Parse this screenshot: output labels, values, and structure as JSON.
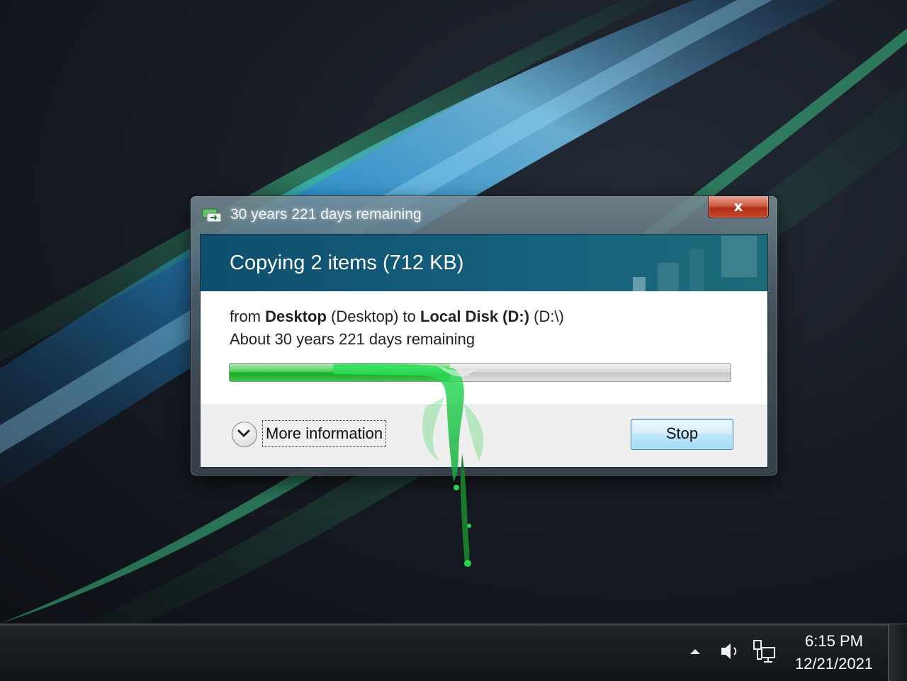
{
  "window": {
    "title": "30 years 221 days remaining",
    "close_label": "x",
    "heading": "Copying 2 items (712 KB)",
    "from_prefix": "from",
    "source_name": "Desktop",
    "source_detail": "(Desktop)",
    "to_word": "to",
    "dest_name": "Local Disk (D:)",
    "dest_detail": "(D:\\)",
    "remaining_text": "About 30 years 221 days remaining",
    "progress_fraction": 0.44,
    "more_info_label": "More information",
    "stop_label": "Stop"
  },
  "taskbar": {
    "time": "6:15 PM",
    "date": "12/21/2021",
    "tray_icons": [
      "show-hidden-icons-arrow-icon",
      "volume-icon",
      "network-icon"
    ]
  },
  "colors": {
    "banner": "#15607c",
    "progress_green": "#1aa826",
    "slime_green": "#1ec83a",
    "close_red": "#c7452a"
  }
}
